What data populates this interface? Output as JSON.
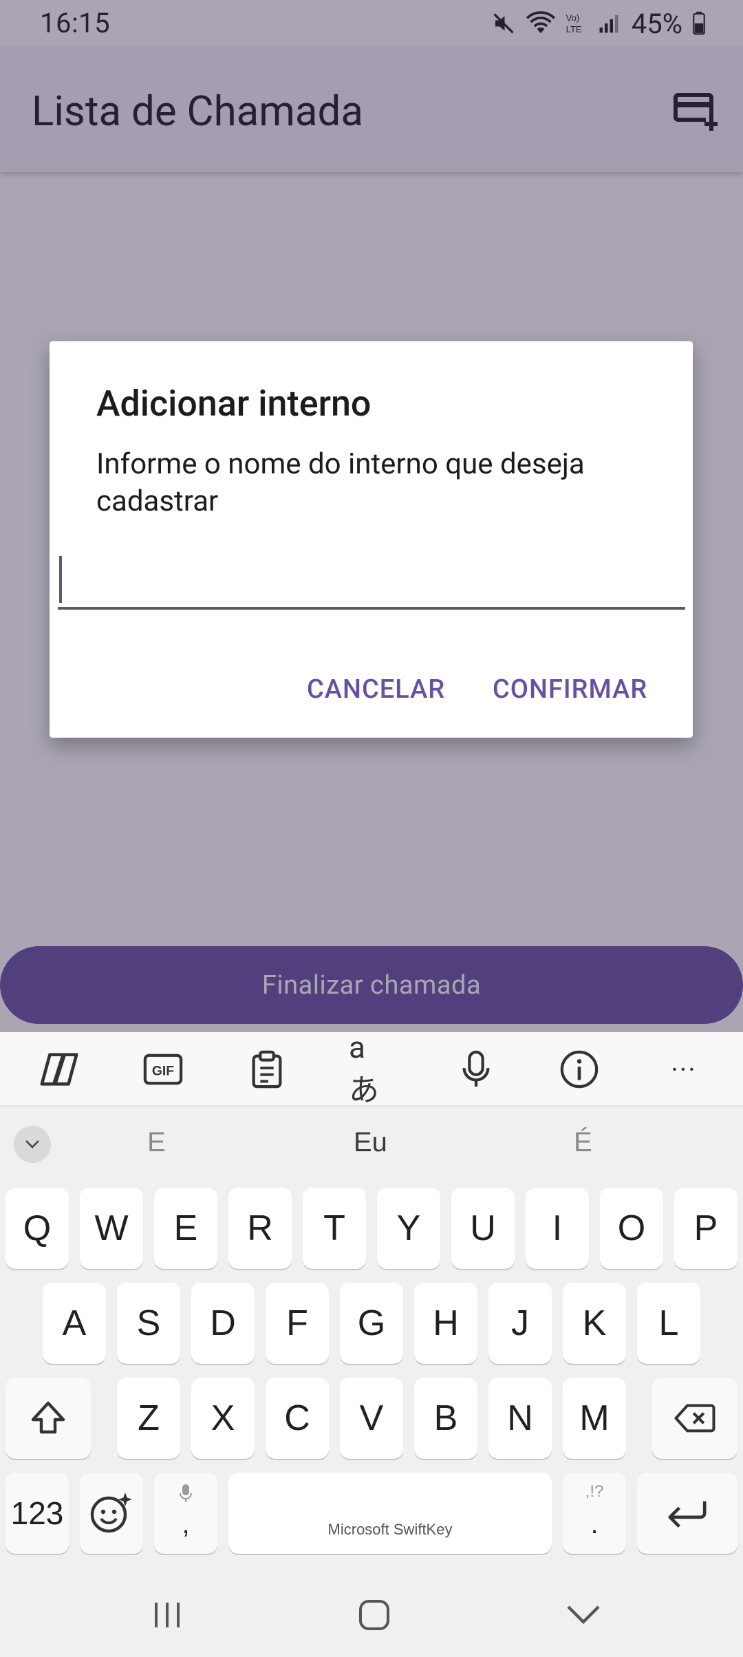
{
  "status_bar": {
    "time": "16:15",
    "battery": "45%",
    "icons": [
      "mute-icon",
      "wifi-icon",
      "volte-icon",
      "signal-icon",
      "battery-icon"
    ]
  },
  "app_bar": {
    "title": "Lista de Chamada",
    "action_icon": "add-card-icon"
  },
  "main": {
    "finish_button": "Finalizar chamada"
  },
  "dialog": {
    "title": "Adicionar interno",
    "message": "Informe o nome do interno que deseja cadastrar",
    "input_value": "",
    "cancel_label": "CANCELAR",
    "confirm_label": "CONFIRMAR"
  },
  "keyboard": {
    "toolbar_icons": [
      "copilot-icon",
      "gif-icon",
      "clipboard-icon",
      "translate-icon",
      "mic-icon",
      "info-icon",
      "more-icon"
    ],
    "gif_label": "GIF",
    "translate_label": "aあ",
    "more_label": "···",
    "suggestions": [
      "E",
      "Eu",
      "É"
    ],
    "row1": [
      "Q",
      "W",
      "E",
      "R",
      "T",
      "Y",
      "U",
      "I",
      "O",
      "P"
    ],
    "row2": [
      "A",
      "S",
      "D",
      "F",
      "G",
      "H",
      "J",
      "K",
      "L"
    ],
    "row3": [
      "Z",
      "X",
      "C",
      "V",
      "B",
      "N",
      "M"
    ],
    "numbers_key": "123",
    "comma_key": ",",
    "period_key": ".",
    "punct_hint": ",!?",
    "space_label": "Microsoft SwiftKey"
  },
  "colors": {
    "primary": "#6750a4",
    "scrim": "rgba(55,40,75,0.42)",
    "keyboard_bg": "#f0f0f0"
  }
}
